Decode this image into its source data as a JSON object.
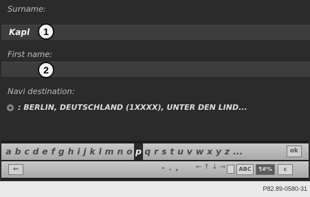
{
  "form": {
    "surname_label": "Surname:",
    "surname_value": "Kapl",
    "firstname_label": "First name:",
    "firstname_value": "",
    "navi_label": "Navi destination:",
    "navi_value": ": BERLIN, DEUTSCHLAND (1XXXX), UNTER DEN LIND..."
  },
  "callouts": {
    "one": "1",
    "two": "2"
  },
  "keyboard": {
    "letters": [
      "a",
      "b",
      "c",
      "d",
      "e",
      "f",
      "g",
      "h",
      "i",
      "j",
      "k",
      "l",
      "m",
      "n",
      "o",
      "p",
      "q",
      "r",
      "s",
      "t",
      "u",
      "v",
      "w",
      "x",
      "y",
      "z",
      "..."
    ],
    "selected_key": "p",
    "ok_label": "ok",
    "back_label": "⇐",
    "punct_label": "- . ,",
    "arrows_label": "← ↑ ↓ →",
    "abc_label": "ABC",
    "num_label": "¶#%",
    "c_label": "c"
  },
  "caption": "P82.89-0580-31"
}
